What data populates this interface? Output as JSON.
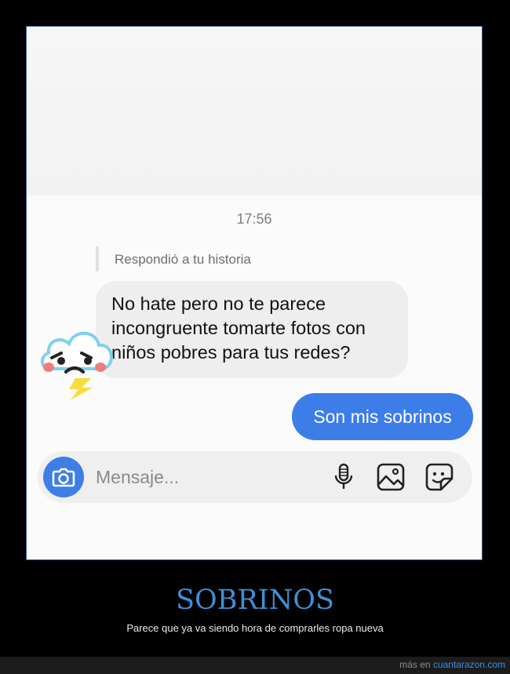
{
  "chat": {
    "timestamp": "17:56",
    "reply_label": "Respondió a tu historia",
    "incoming_message": "No hate pero no te parece incongruente tomarte fotos con niños pobres para tus redes?",
    "outgoing_message": "Son mis sobrinos",
    "input": {
      "placeholder": "Mensaje..."
    },
    "icons": [
      "camera-icon",
      "microphone-icon",
      "image-gallery-icon",
      "sticker-icon"
    ],
    "accent_color": "#3c7de8"
  },
  "caption": {
    "title": "SOBRINOS",
    "subtitle": "Parece que ya va siendo hora de comprarles ropa nueva"
  },
  "footer": {
    "prefix": "más en",
    "link_text": "cuantarazon.com"
  }
}
